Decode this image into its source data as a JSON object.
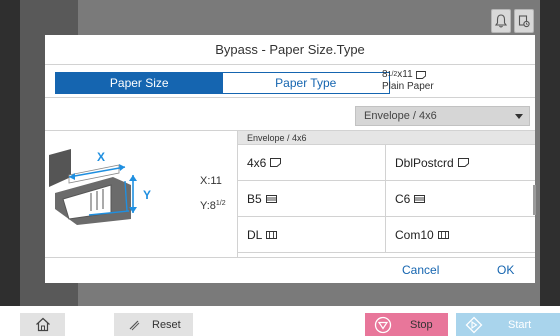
{
  "dialog": {
    "title": "Bypass - Paper Size.Type",
    "tabs": [
      {
        "label": "Paper Size",
        "active": true
      },
      {
        "label": "Paper Type",
        "active": false
      }
    ],
    "current": {
      "size_main": "8",
      "size_frac": "1/2",
      "size_rest": "x11",
      "type": "Plain Paper"
    },
    "dropdown": {
      "selected": "Envelope / 4x6"
    },
    "illustration": {
      "x_label": "X",
      "y_label": "Y",
      "x_value": "X:11",
      "y_main": "Y:8",
      "y_frac": "1/2"
    },
    "list": {
      "header": "Envelope / 4x6",
      "rows": [
        [
          {
            "label": "4x6",
            "icon": "portrait-paper-icon"
          },
          {
            "label": "DblPostcrd",
            "icon": "portrait-paper-icon"
          }
        ],
        [
          {
            "label": "B5",
            "icon": "envelope-landscape-icon"
          },
          {
            "label": "C6",
            "icon": "envelope-landscape-icon"
          }
        ],
        [
          {
            "label": "DL",
            "icon": "envelope-portrait-icon"
          },
          {
            "label": "Com10",
            "icon": "envelope-portrait-icon"
          }
        ]
      ]
    },
    "buttons": {
      "cancel": "Cancel",
      "ok": "OK"
    }
  },
  "top_icons": [
    "bell-icon",
    "job-status-icon"
  ],
  "bottom_bar": {
    "reset": "Reset",
    "stop": "Stop",
    "start": "Start"
  },
  "colors": {
    "accent": "#1565b0",
    "stop": "#e8769a",
    "start": "#a9d4ec",
    "illustration_blue": "#1f8fe0"
  }
}
